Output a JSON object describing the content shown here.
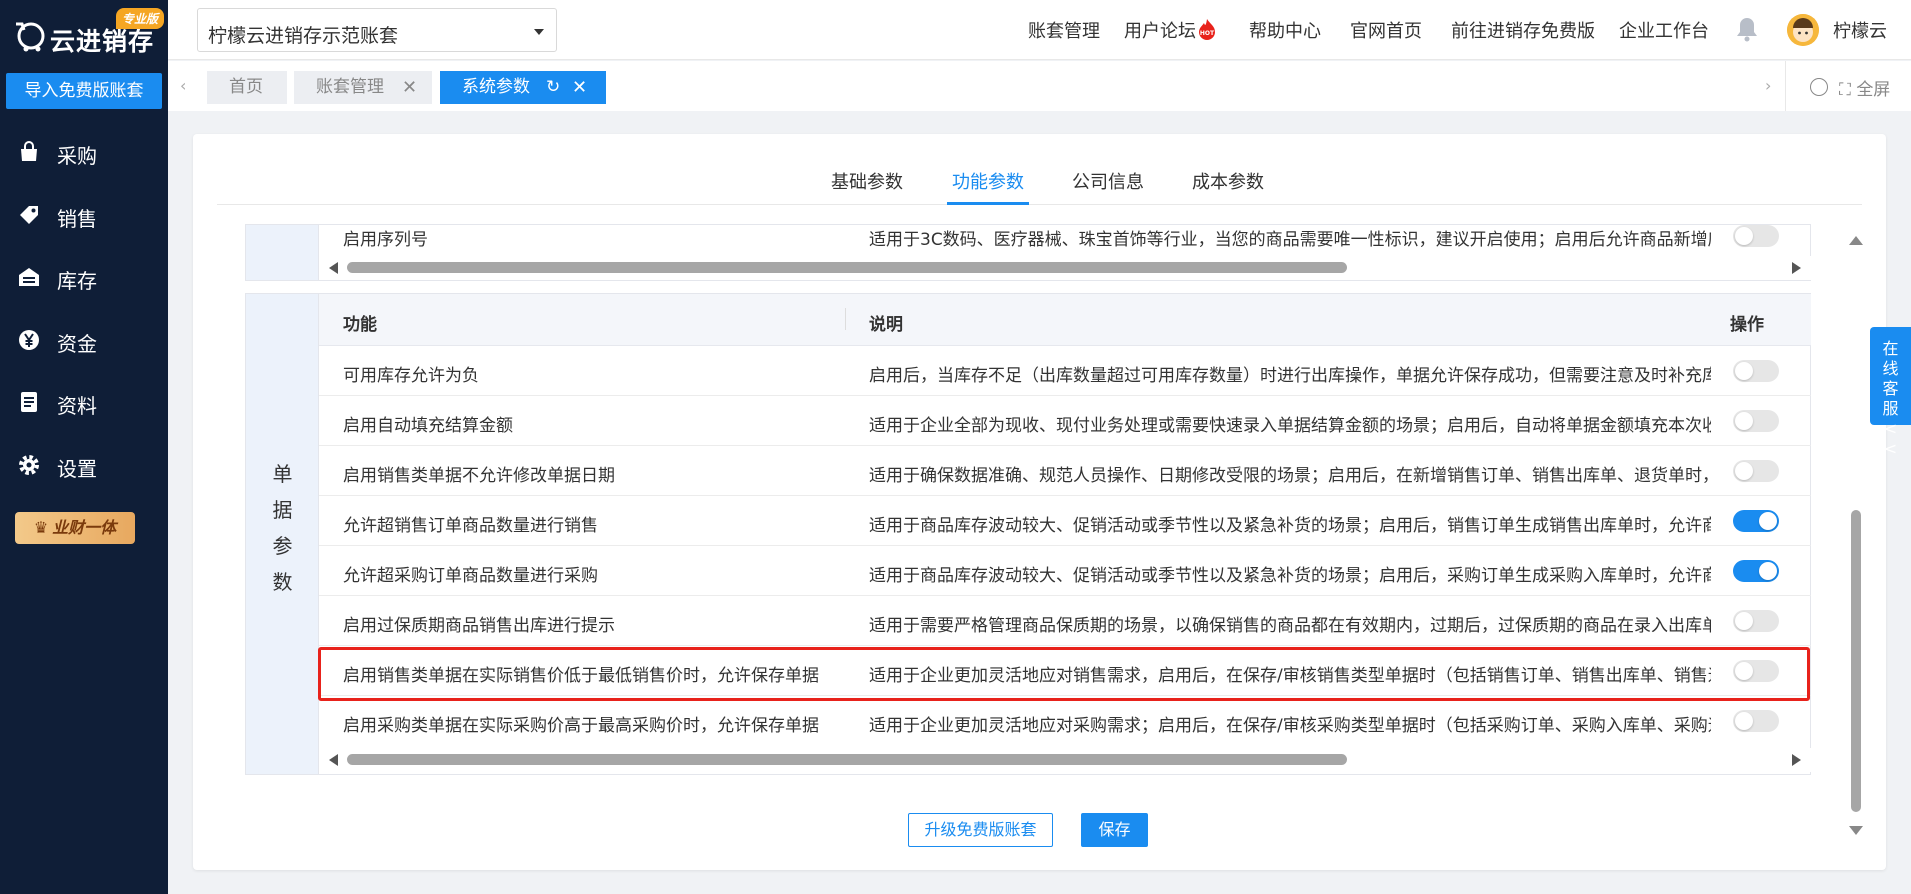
{
  "brand": {
    "name": "云进销存",
    "badge": "专业版"
  },
  "sidebar": {
    "import_button": "导入免费版账套",
    "items": [
      {
        "label": "采购",
        "icon": "bag-icon"
      },
      {
        "label": "销售",
        "icon": "tag-icon"
      },
      {
        "label": "库存",
        "icon": "warehouse-icon"
      },
      {
        "label": "资金",
        "icon": "yen-icon"
      },
      {
        "label": "资料",
        "icon": "document-icon"
      },
      {
        "label": "设置",
        "icon": "gear-icon"
      }
    ],
    "promo": "业财一体"
  },
  "header": {
    "account_select": "柠檬云进销存示范账套",
    "links": [
      "账套管理",
      "用户论坛",
      "帮助中心",
      "官网首页",
      "前往进销存免费版",
      "企业工作台"
    ],
    "hot_badge": "HOT",
    "user_name": "柠檬云"
  },
  "tabs": {
    "items": [
      "首页",
      "账套管理",
      "系统参数"
    ],
    "active": "系统参数",
    "fullscreen": "全屏"
  },
  "subtabs": {
    "items": [
      "基础参数",
      "功能参数",
      "公司信息",
      "成本参数"
    ],
    "active": "功能参数"
  },
  "top_section": {
    "row": {
      "func": "启用序列号",
      "desc": "适用于3C数码、医疗器械、珠宝首饰等行业，当您的商品需要唯一性标识，建议开启使用；启用后允许商品新增序列号",
      "enabled": false
    }
  },
  "doc_section": {
    "group_label": [
      "单",
      "据",
      "参",
      "数"
    ],
    "headers": {
      "func": "功能",
      "desc": "说明",
      "action": "操作"
    },
    "rows": [
      {
        "func": "可用库存允许为负",
        "desc": "启用后，当库存不足（出库数量超过可用库存数量）时进行出库操作，单据允许保存成功，但需要注意及时补充库存",
        "enabled": false
      },
      {
        "func": "启用自动填充结算金额",
        "desc": "适用于企业全部为现收、现付业务处理或需要快速录入单据结算金额的场景；启用后，自动将单据金额填充本次收",
        "enabled": false
      },
      {
        "func": "启用销售类单据不允许修改单据日期",
        "desc": "适用于确保数据准确、规范人员操作、日期修改受限的场景；启用后，在新增销售订单、销售出库单、退货单时，",
        "enabled": false
      },
      {
        "func": "允许超销售订单商品数量进行销售",
        "desc": "适用于商品库存波动较大、促销活动或季节性以及紧急补货的场景；启用后，销售订单生成销售出库单时，允许商",
        "enabled": true
      },
      {
        "func": "允许超采购订单商品数量进行采购",
        "desc": "适用于商品库存波动较大、促销活动或季节性以及紧急补货的场景；启用后，采购订单生成采购入库单时，允许商",
        "enabled": true
      },
      {
        "func": "启用过保质期商品销售出库进行提示",
        "desc": "适用于需要严格管理商品保质期的场景，以确保销售的商品都在有效期内，过期后，过保质期的商品在录入出库单",
        "enabled": false
      },
      {
        "func": "启用销售类单据在实际销售价低于最低销售价时，允许保存单据",
        "desc": "适用于企业更加灵活地应对销售需求，启用后，在保存/审核销售类型单据时（包括销售订单、销售出库单、销售退",
        "enabled": false
      },
      {
        "func": "启用采购类单据在实际采购价高于最高采购价时，允许保存单据",
        "desc": "适用于企业更加灵活地应对采购需求；启用后，在保存/审核采购类型单据时（包括采购订单、采购入库单、采购退",
        "enabled": false
      }
    ]
  },
  "buttons": {
    "upgrade": "升级免费版账套",
    "save": "保存"
  },
  "customer_service": "在线客服<<",
  "colors": {
    "primary": "#1a8cf0",
    "sidebar": "#0f1e37",
    "highlight": "#e8221b"
  }
}
